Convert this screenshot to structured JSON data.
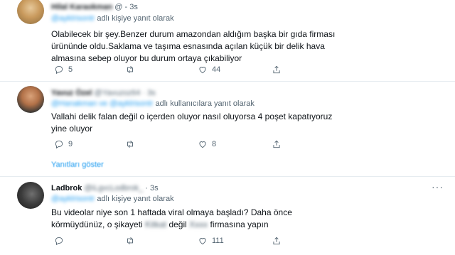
{
  "tweets": [
    {
      "name": "Hilal Karaokman",
      "handle": "@ - 3s",
      "reply_mention": "@ayklrisontr",
      "reply_suffix": "adlı kişiye yanıt olarak",
      "text": "Olabilecek bir şey.Benzer durum amazondan aldığım başka bir gıda firması ürününde oldu.Saklama ve taşıma esnasında açılan küçük bir delik hava almasına sebep oluyor  bu durum ortaya çıkabiliyor",
      "replies": "5",
      "retweets": "",
      "likes": "44"
    },
    {
      "name": "Yavuz Özel",
      "handle": "@Yavuzoz64 · 3s",
      "reply_mention": "@Hanakman ve @ayklrisontr",
      "reply_suffix": "adlı kullanıcılara yanıt olarak",
      "text": "Vallahi delik falan değil o içerden oluyor nasıl oluyorsa 4 poşet kapatıyoruz yine oluyor",
      "replies": "9",
      "retweets": "",
      "likes": "8"
    },
    {
      "name": "Ladbrok",
      "handle_blur": "@iLgvcLodbrok_",
      "handle": "· 3s",
      "reply_mention": "@ayklrisontr",
      "reply_suffix": "adlı kişiye yanıt olarak",
      "text_a": "Bu videolar niye son 1 haftada viral olmaya başladı? Daha önce körmüydünüz, o şikayeti",
      "text_blur1": "Kitkat",
      "text_b": "değil",
      "text_blur2": "Xxxx",
      "text_c": "firmasına yapın",
      "replies": "",
      "retweets": "",
      "likes": "111"
    }
  ],
  "show_replies": "Yanıtları göster",
  "icons": [
    "reply-icon",
    "retweet-icon",
    "like-icon",
    "share-icon",
    "more-icon"
  ]
}
